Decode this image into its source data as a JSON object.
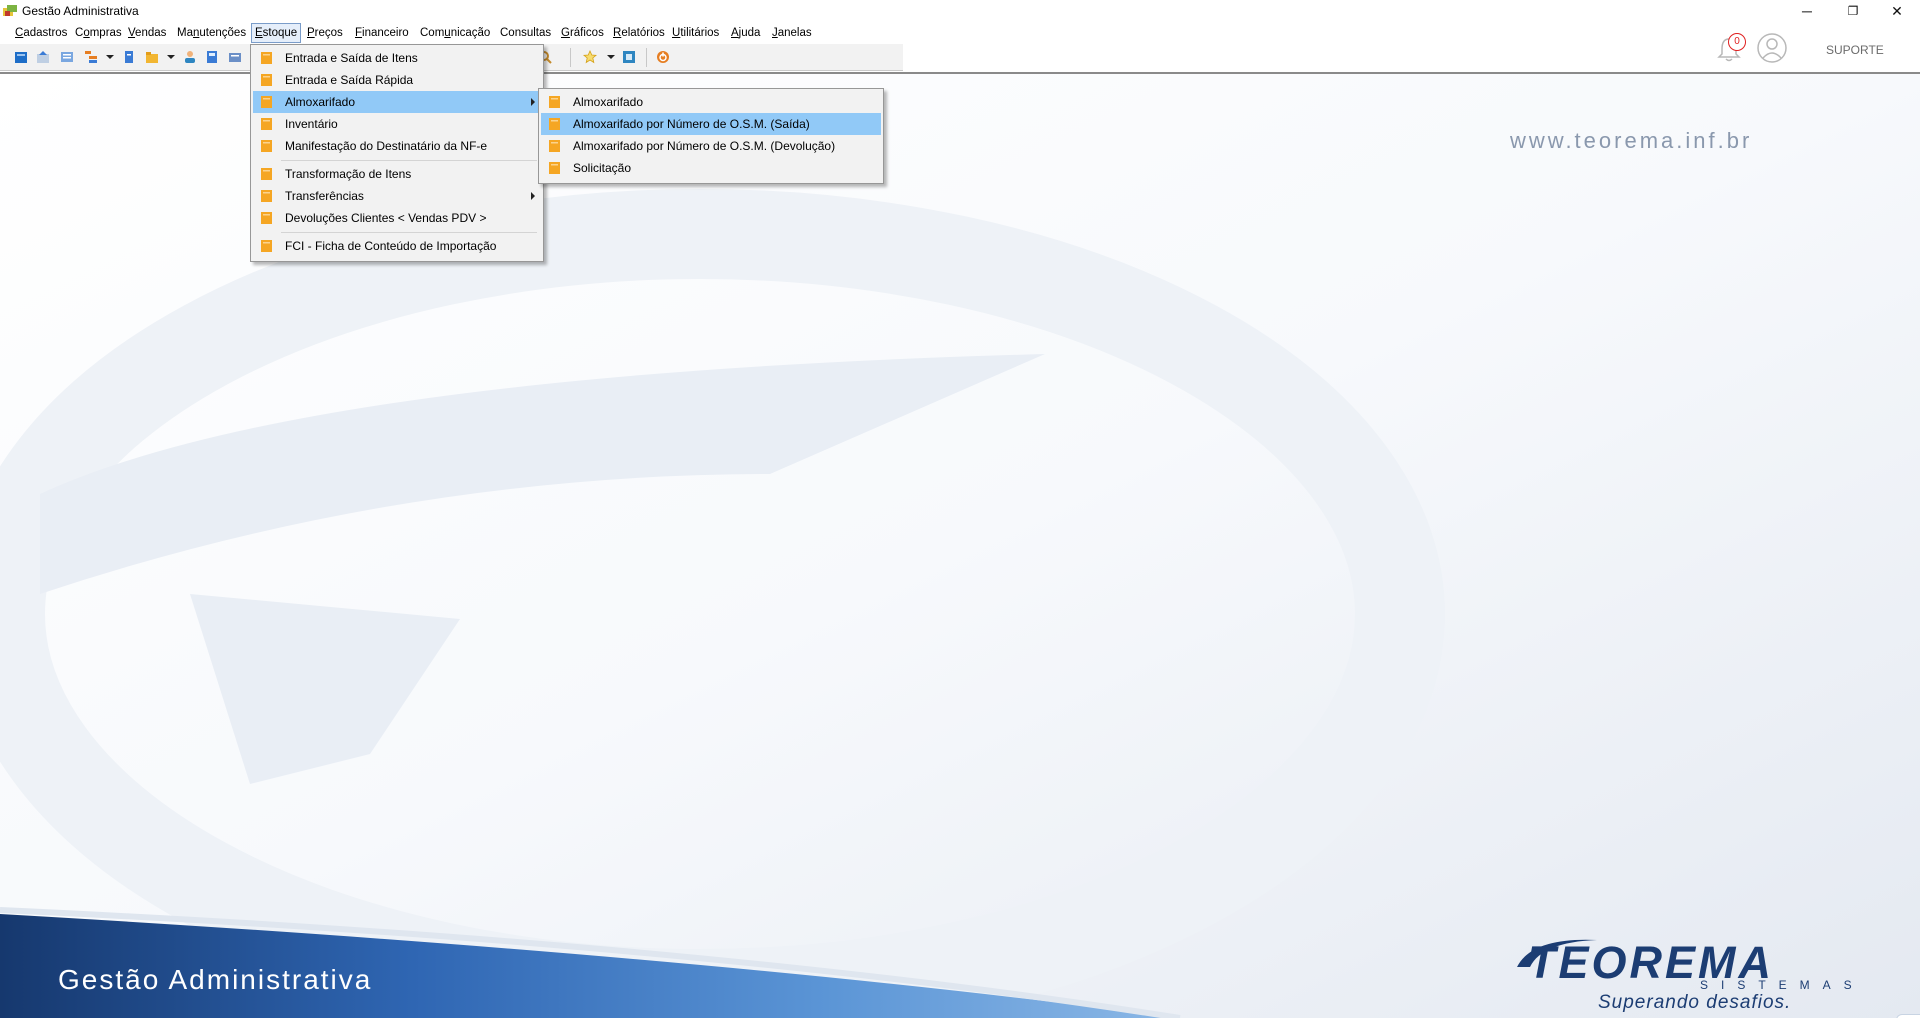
{
  "window": {
    "title": "Gestão Administrativa",
    "controls": {
      "minimize": "─",
      "restore": "❐",
      "close": "✕"
    }
  },
  "menubar": {
    "items": [
      {
        "label": "Cadastros",
        "key": "C"
      },
      {
        "label": "Compras",
        "key": "o"
      },
      {
        "label": "Vendas",
        "key": "V"
      },
      {
        "label": "Manutenções",
        "key": "n"
      },
      {
        "label": "Estoque",
        "key": "E",
        "active": true
      },
      {
        "label": "Preços",
        "key": "P"
      },
      {
        "label": "Financeiro",
        "key": "F"
      },
      {
        "label": "Comunicação",
        "key": "u"
      },
      {
        "label": "Consultas",
        "key": ""
      },
      {
        "label": "Gráficos",
        "key": "G"
      },
      {
        "label": "Relatórios",
        "key": "R"
      },
      {
        "label": "Utilitários",
        "key": "U"
      },
      {
        "label": "Ajuda",
        "key": "A"
      },
      {
        "label": "Janelas",
        "key": "J"
      }
    ]
  },
  "header": {
    "notification_count": "0",
    "user_label": "SUPORTE"
  },
  "estoque_menu": {
    "items": [
      {
        "label": "Entrada e Saída de Itens"
      },
      {
        "label": "Entrada e Saída Rápida"
      },
      {
        "label": "Almoxarifado",
        "submenu": true,
        "selected": true
      },
      {
        "label": "Inventário"
      },
      {
        "label": "Manifestação do Destinatário da NF-e"
      },
      {
        "label": "Transformação de Itens"
      },
      {
        "label": "Transferências",
        "submenu": true
      },
      {
        "label": "Devoluções Clientes < Vendas PDV >"
      },
      {
        "label": "FCI - Ficha de Conteúdo de Importação"
      }
    ]
  },
  "almoxarifado_submenu": {
    "items": [
      {
        "label": "Almoxarifado"
      },
      {
        "label": "Almoxarifado por Número de O.S.M. (Saída)",
        "selected": true
      },
      {
        "label": "Almoxarifado por Número de O.S.M. (Devolução)"
      },
      {
        "label": "Solicitação"
      }
    ]
  },
  "background": {
    "website": "www.teorema.inf.br",
    "footer_title": "Gestão Administrativa",
    "logo_name": "TEOREMA",
    "logo_subtitle": "SISTEMAS",
    "logo_tagline": "Superando desafios."
  },
  "colors": {
    "menu_selected": "#91c9f7",
    "menu_bg": "#f2f2f2",
    "brand_navy": "#1c3d73",
    "footer_band": "#1f4d94",
    "badge_red": "#e02020",
    "menu_icon": "#f5a623"
  },
  "icons": {
    "menu_item": "orange-document-icon",
    "toolbar": [
      "new-document-icon",
      "import-icon",
      "grid-icon",
      "tree-icon",
      "blue-document-icon",
      "folder-icon",
      "user-icon",
      "calculator-icon",
      "card-icon",
      "search-icon",
      "star-icon",
      "blue-box-icon",
      "power-icon"
    ]
  }
}
